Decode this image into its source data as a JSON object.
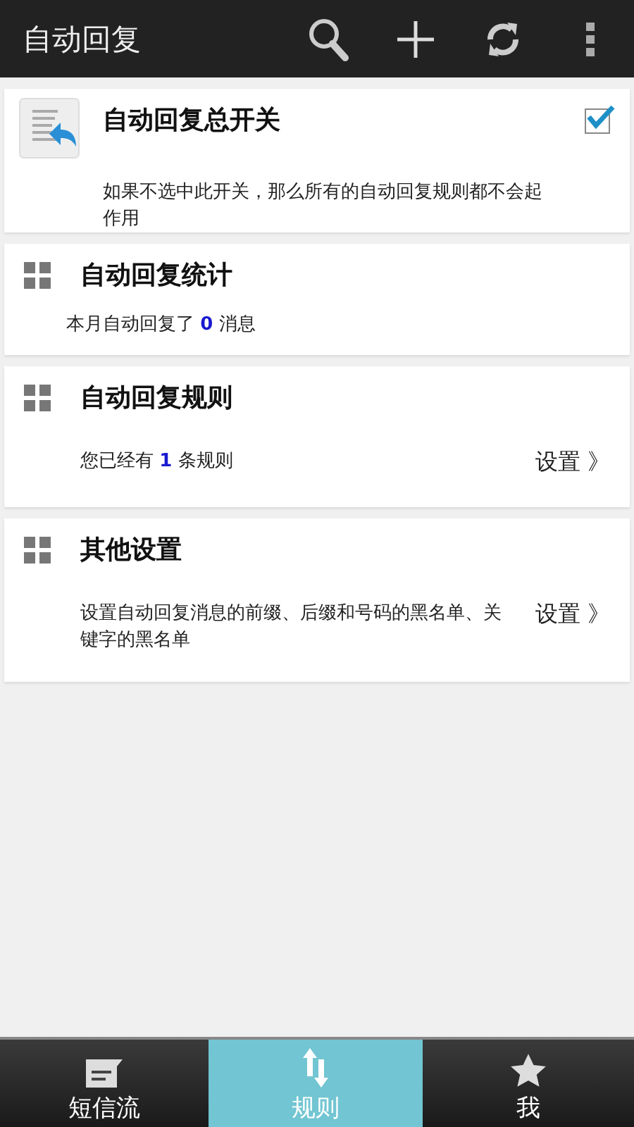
{
  "app_bar": {
    "title": "自动回复",
    "actions": [
      {
        "kind": "search"
      },
      {
        "kind": "add"
      },
      {
        "kind": "refresh"
      },
      {
        "kind": "more"
      }
    ]
  },
  "master_switch": {
    "title": "自动回复总开关",
    "description": "如果不选中此开关，那么所有的自动回复规则都不会起作用",
    "checked": true
  },
  "sections": [
    {
      "title": "自动回复统计",
      "before": "本月自动回复了 ",
      "count": "0",
      "after": " 消息"
    },
    {
      "title": "自动回复规则",
      "before": "您已经有 ",
      "count": "1",
      "after": " 条规则",
      "link": "设置 》"
    },
    {
      "title": "其他设置",
      "before": "设置自动回复消息的前缀、后缀和号码的黑名单、关键字的黑名单",
      "link": "设置 》"
    }
  ],
  "bottom_nav": [
    {
      "label": "短信流",
      "kind": "message",
      "selected": false
    },
    {
      "label": "规则",
      "kind": "sort",
      "selected": true
    },
    {
      "label": "我",
      "kind": "star",
      "selected": false
    }
  ]
}
